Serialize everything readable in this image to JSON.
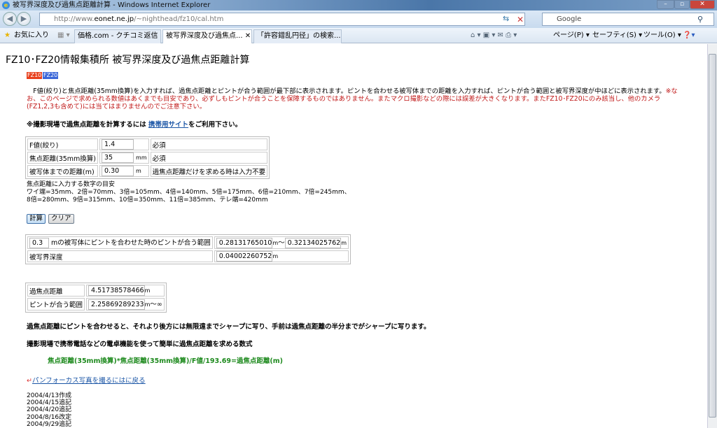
{
  "window": {
    "title": "被写界深度及び過焦点距離計算 - Windows Internet Explorer",
    "url_prefix": "http://www.",
    "url_domain": "eonet.ne.jp",
    "url_path": "/~nighthead/fz10/cal.htm",
    "search_placeholder": "Google"
  },
  "toolbar": {
    "favorites": "お気に入り",
    "tabs": [
      "価格.com - クチコミ返信",
      "被写界深度及び過焦点...",
      "「許容錯乱円径」の検索..."
    ],
    "page": "ページ(P)",
    "safety": "セーフティ(S)",
    "tools": "ツール(O)"
  },
  "page": {
    "title": "FZ10･FZ20情報集積所  被写界深度及び過焦点距離計算",
    "badge1": "FZ10",
    "badge2": "FZ20",
    "desc_black": "　F値(絞り)と焦点距離(35mm換算)を入力すれば、過焦点距離とピントが合う範囲が最下部に表示されます。ピントを合わせる被写体までの距離を入力すれば、ピントが合う範囲と被写界深度が中ほどに表示されます。",
    "desc_red": "※なお、このページで求められる数値はあくまでも目安であり、必ずしもピントが合うことを保障するものではありません。またマクロ撮影などの際には誤差が大きくなります。またFZ10･FZ20にのみ該当し、他のカメラ(FZ1,2,3も含めて)には当てはまりませんのでご注意下さい。",
    "note_pre": "※撮影現場で過焦点距離を計算するには ",
    "note_link": "携帯用サイト",
    "note_post": "をご利用下さい。",
    "inputs": [
      {
        "label": "F値(絞り)",
        "value": "1.4",
        "unit": "",
        "note": "必須"
      },
      {
        "label": "焦点距離(35mm換算)",
        "value": "35",
        "unit": "mm",
        "note": "必須"
      },
      {
        "label": "被写体までの距離(m)",
        "value": "0.30",
        "unit": "m",
        "note": "過焦点距離だけを求める時は入力不要"
      }
    ],
    "guide_title": "焦点距離に入力する数字の目安",
    "guide_1": "ワイ端=35mm、2倍=70mm、3倍=105mm、4倍=140mm、5倍=175mm、6倍=210mm、7倍=245mm、",
    "guide_2": "8倍=280mm、9倍=315mm、10倍=350mm、11倍=385mm、テレ端=420mm",
    "calc": "計算",
    "clear": "クリア",
    "result": {
      "dist": "0.3",
      "range_label": "mの被写体にピントを合わせた時のピントが合う範囲",
      "near": "0.28131765010",
      "far": "0.32134025762",
      "unit": "m",
      "sep": "～",
      "dof_label": "被写界深度",
      "dof": "0.04002260752"
    },
    "hyper": {
      "label": "過焦点距離",
      "value": "4.51738578466",
      "range_label": "ピントが合う範囲",
      "range": "2.25869289233",
      "inf": "～∞"
    },
    "explain": "過焦点距離にピントを合わせると、それより後方には無限遠までシャープに写り、手前は過焦点距離の半分までがシャープに写ります。",
    "formula_title": "撮影現場で携帯電話などの電卓機能を使って簡単に過焦点距離を求める数式",
    "formula": "焦点距離(35mm換算)*焦点距離(35mm換算)/F値/193.69=過焦点距離(m)",
    "back_link": "パンフォーカス写真を撮るにはに戻る",
    "history": [
      "2004/4/13作成",
      "2004/4/15追記",
      "2004/4/20追記",
      "2004/8/16改定",
      "2004/9/29追記"
    ]
  },
  "colors": {
    "red": "#c01818",
    "green": "#1e8a1e",
    "fz10": "#e8401c",
    "fz20": "#3a66d8"
  }
}
